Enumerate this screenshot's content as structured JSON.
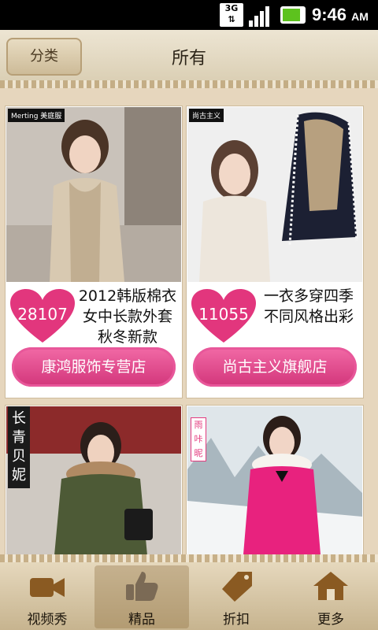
{
  "status_bar": {
    "network": "3G",
    "time": "9:46",
    "ampm": "AM"
  },
  "header": {
    "category_button": "分类",
    "title": "所有"
  },
  "cards": [
    {
      "brand": "Merting 美庭服",
      "likes": "28107",
      "description": "2012韩版棉衣女中长款外套 秋冬新款",
      "shop": "康鸿服饰专营店"
    },
    {
      "brand": "尚古主义",
      "likes": "11055",
      "description": "一衣多穿四季不同风格出彩",
      "shop": "尚古主义旗舰店"
    },
    {
      "brand": "长青贝妮"
    },
    {
      "brand": "雨咔昵"
    }
  ],
  "bottom_nav": [
    {
      "label": "视频秀",
      "icon": "video-camera-icon",
      "active": false
    },
    {
      "label": "精品",
      "icon": "thumbs-up-icon",
      "active": true
    },
    {
      "label": "折扣",
      "icon": "price-tag-icon",
      "active": false
    },
    {
      "label": "更多",
      "icon": "home-icon",
      "active": false
    }
  ],
  "colors": {
    "accent_pink": "#d2357a",
    "heart_pink": "#e2367d",
    "leather": "#d8ccb0",
    "nav_brown": "#8a5a22"
  }
}
